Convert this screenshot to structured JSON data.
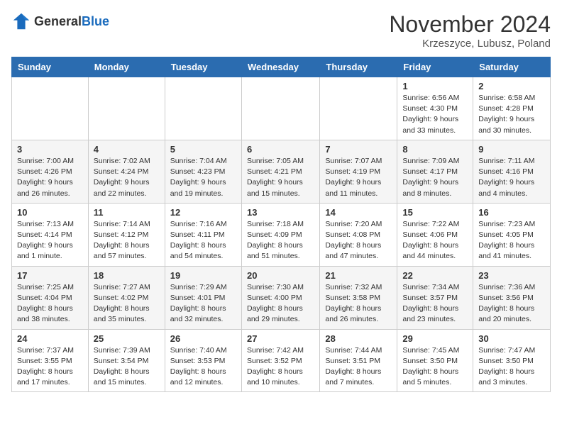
{
  "logo": {
    "general": "General",
    "blue": "Blue"
  },
  "title": "November 2024",
  "location": "Krzeszyce, Lubusz, Poland",
  "weekdays": [
    "Sunday",
    "Monday",
    "Tuesday",
    "Wednesday",
    "Thursday",
    "Friday",
    "Saturday"
  ],
  "weeks": [
    [
      {
        "day": "",
        "info": ""
      },
      {
        "day": "",
        "info": ""
      },
      {
        "day": "",
        "info": ""
      },
      {
        "day": "",
        "info": ""
      },
      {
        "day": "",
        "info": ""
      },
      {
        "day": "1",
        "info": "Sunrise: 6:56 AM\nSunset: 4:30 PM\nDaylight: 9 hours\nand 33 minutes."
      },
      {
        "day": "2",
        "info": "Sunrise: 6:58 AM\nSunset: 4:28 PM\nDaylight: 9 hours\nand 30 minutes."
      }
    ],
    [
      {
        "day": "3",
        "info": "Sunrise: 7:00 AM\nSunset: 4:26 PM\nDaylight: 9 hours\nand 26 minutes."
      },
      {
        "day": "4",
        "info": "Sunrise: 7:02 AM\nSunset: 4:24 PM\nDaylight: 9 hours\nand 22 minutes."
      },
      {
        "day": "5",
        "info": "Sunrise: 7:04 AM\nSunset: 4:23 PM\nDaylight: 9 hours\nand 19 minutes."
      },
      {
        "day": "6",
        "info": "Sunrise: 7:05 AM\nSunset: 4:21 PM\nDaylight: 9 hours\nand 15 minutes."
      },
      {
        "day": "7",
        "info": "Sunrise: 7:07 AM\nSunset: 4:19 PM\nDaylight: 9 hours\nand 11 minutes."
      },
      {
        "day": "8",
        "info": "Sunrise: 7:09 AM\nSunset: 4:17 PM\nDaylight: 9 hours\nand 8 minutes."
      },
      {
        "day": "9",
        "info": "Sunrise: 7:11 AM\nSunset: 4:16 PM\nDaylight: 9 hours\nand 4 minutes."
      }
    ],
    [
      {
        "day": "10",
        "info": "Sunrise: 7:13 AM\nSunset: 4:14 PM\nDaylight: 9 hours\nand 1 minute."
      },
      {
        "day": "11",
        "info": "Sunrise: 7:14 AM\nSunset: 4:12 PM\nDaylight: 8 hours\nand 57 minutes."
      },
      {
        "day": "12",
        "info": "Sunrise: 7:16 AM\nSunset: 4:11 PM\nDaylight: 8 hours\nand 54 minutes."
      },
      {
        "day": "13",
        "info": "Sunrise: 7:18 AM\nSunset: 4:09 PM\nDaylight: 8 hours\nand 51 minutes."
      },
      {
        "day": "14",
        "info": "Sunrise: 7:20 AM\nSunset: 4:08 PM\nDaylight: 8 hours\nand 47 minutes."
      },
      {
        "day": "15",
        "info": "Sunrise: 7:22 AM\nSunset: 4:06 PM\nDaylight: 8 hours\nand 44 minutes."
      },
      {
        "day": "16",
        "info": "Sunrise: 7:23 AM\nSunset: 4:05 PM\nDaylight: 8 hours\nand 41 minutes."
      }
    ],
    [
      {
        "day": "17",
        "info": "Sunrise: 7:25 AM\nSunset: 4:04 PM\nDaylight: 8 hours\nand 38 minutes."
      },
      {
        "day": "18",
        "info": "Sunrise: 7:27 AM\nSunset: 4:02 PM\nDaylight: 8 hours\nand 35 minutes."
      },
      {
        "day": "19",
        "info": "Sunrise: 7:29 AM\nSunset: 4:01 PM\nDaylight: 8 hours\nand 32 minutes."
      },
      {
        "day": "20",
        "info": "Sunrise: 7:30 AM\nSunset: 4:00 PM\nDaylight: 8 hours\nand 29 minutes."
      },
      {
        "day": "21",
        "info": "Sunrise: 7:32 AM\nSunset: 3:58 PM\nDaylight: 8 hours\nand 26 minutes."
      },
      {
        "day": "22",
        "info": "Sunrise: 7:34 AM\nSunset: 3:57 PM\nDaylight: 8 hours\nand 23 minutes."
      },
      {
        "day": "23",
        "info": "Sunrise: 7:36 AM\nSunset: 3:56 PM\nDaylight: 8 hours\nand 20 minutes."
      }
    ],
    [
      {
        "day": "24",
        "info": "Sunrise: 7:37 AM\nSunset: 3:55 PM\nDaylight: 8 hours\nand 17 minutes."
      },
      {
        "day": "25",
        "info": "Sunrise: 7:39 AM\nSunset: 3:54 PM\nDaylight: 8 hours\nand 15 minutes."
      },
      {
        "day": "26",
        "info": "Sunrise: 7:40 AM\nSunset: 3:53 PM\nDaylight: 8 hours\nand 12 minutes."
      },
      {
        "day": "27",
        "info": "Sunrise: 7:42 AM\nSunset: 3:52 PM\nDaylight: 8 hours\nand 10 minutes."
      },
      {
        "day": "28",
        "info": "Sunrise: 7:44 AM\nSunset: 3:51 PM\nDaylight: 8 hours\nand 7 minutes."
      },
      {
        "day": "29",
        "info": "Sunrise: 7:45 AM\nSunset: 3:50 PM\nDaylight: 8 hours\nand 5 minutes."
      },
      {
        "day": "30",
        "info": "Sunrise: 7:47 AM\nSunset: 3:50 PM\nDaylight: 8 hours\nand 3 minutes."
      }
    ]
  ]
}
